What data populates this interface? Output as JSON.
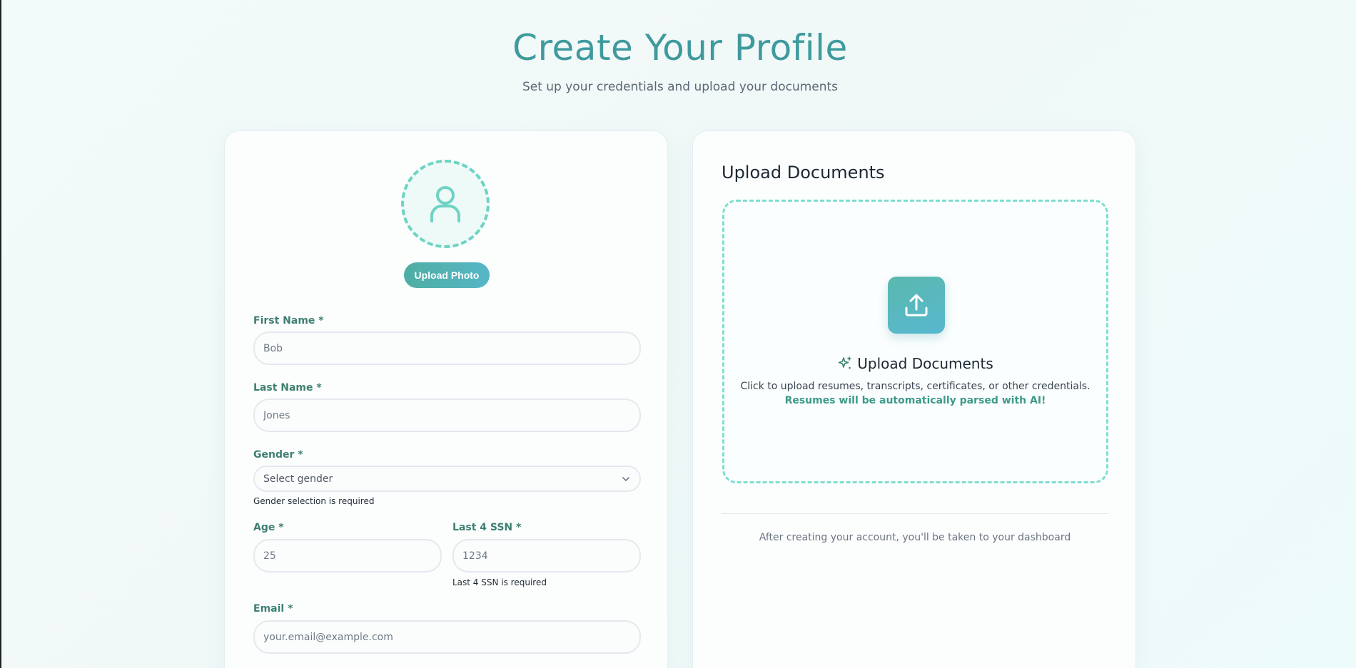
{
  "header": {
    "title": "Create Your Profile",
    "subtitle": "Set up your credentials and upload your documents"
  },
  "profile_form": {
    "upload_photo_label": "Upload Photo",
    "first_name": {
      "label": "First Name *",
      "placeholder": "Bob"
    },
    "last_name": {
      "label": "Last Name *",
      "placeholder": "Jones"
    },
    "gender": {
      "label": "Gender *",
      "selected": "Select gender",
      "error": "Gender selection is required"
    },
    "age": {
      "label": "Age *",
      "placeholder": "25"
    },
    "ssn": {
      "label": "Last 4 SSN *",
      "placeholder": "1234",
      "error": "Last 4 SSN is required"
    },
    "email": {
      "label": "Email *",
      "placeholder": "your.email@example.com"
    }
  },
  "documents": {
    "section_title": "Upload Documents",
    "dropzone_title": "Upload Documents",
    "dropzone_description": "Click to upload resumes, transcripts, certificates, or other credentials.",
    "dropzone_ai_note": "Resumes will be automatically parsed with AI!",
    "footer_note": "After creating your account, you'll be taken to your dashboard"
  },
  "icons": {
    "avatar": "user-icon",
    "upload": "upload-icon",
    "sparkle": "sparkles-icon",
    "chevron": "chevron-down-icon"
  },
  "colors": {
    "accent": "#3f9a9d",
    "label_green": "#3e7f71",
    "dashed_teal": "#6dd3c2",
    "button_gradient_start": "#4eaea4",
    "button_gradient_end": "#56b6c6"
  }
}
